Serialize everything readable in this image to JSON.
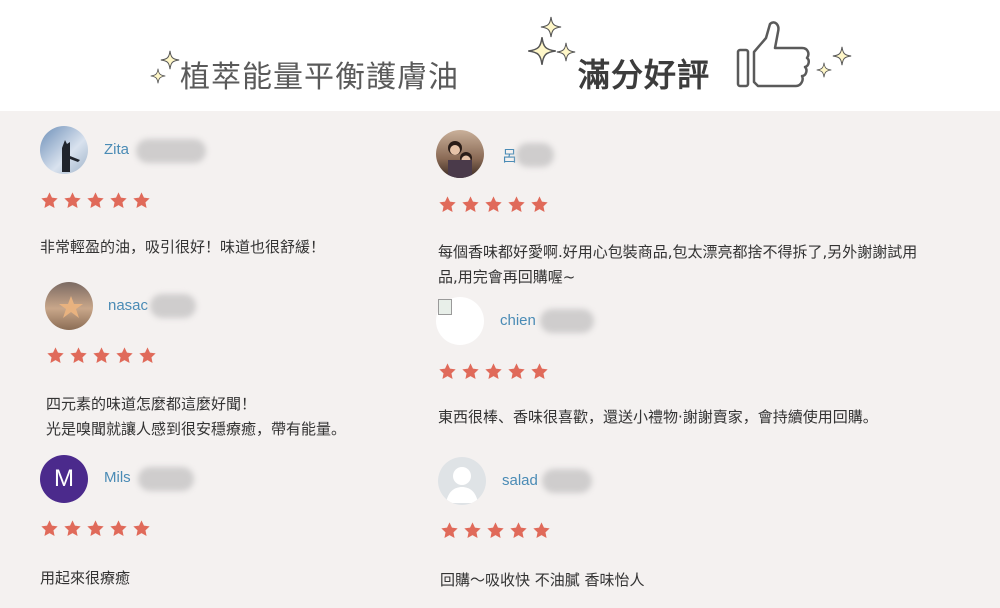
{
  "header": {
    "title_main": "植萃能量平衡護膚油",
    "title_highlight": "滿分好評"
  },
  "colors": {
    "star": "#e06a5a",
    "name": "#4a8bb5",
    "background": "#f4f1f0",
    "avatar_m": "#4b2a8c"
  },
  "reviews": [
    {
      "name": "Zita",
      "avatar": "photo-cat-icon",
      "rating": 5,
      "text": [
        "非常輕盈的油，吸引很好！味道也很舒緩！"
      ]
    },
    {
      "name": "nasac",
      "avatar": "photo-starfish-icon",
      "rating": 5,
      "text": [
        "四元素的味道怎麼都這麼好聞！",
        "光是嗅聞就讓人感到很安穩療癒，帶有能量。"
      ]
    },
    {
      "name": "Mils",
      "avatar_letter": "M",
      "rating": 5,
      "text": [
        "用起來很療癒"
      ]
    },
    {
      "name": "呂",
      "avatar": "photo-people-icon",
      "rating": 5,
      "text": [
        "每個香味都好愛啊.好用心包裝商品,包太漂亮都捨不得拆了,另外謝謝試用",
        "品,用完會再回購喔~"
      ]
    },
    {
      "name": "chien",
      "avatar": "broken-image-icon",
      "rating": 5,
      "text": [
        "東西很棒、香味很喜歡，還送小禮物·謝謝賣家，會持續使用回購。"
      ]
    },
    {
      "name": "salad",
      "avatar": "default-user-icon",
      "rating": 5,
      "text": [
        "回購～吸收快 不油膩 香味怡人"
      ]
    }
  ]
}
